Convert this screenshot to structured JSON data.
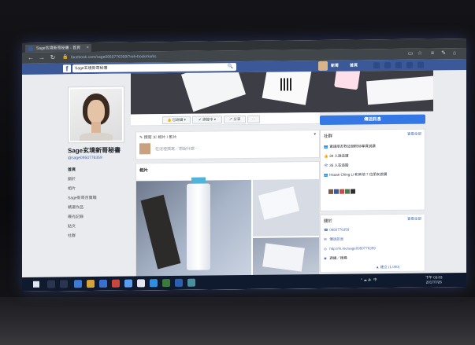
{
  "browser": {
    "tab_title": "Sage玄境新哥秘書 - 首頁",
    "tab_close": "×",
    "url": "facebook.com/sage0950776359/?ref=bookmarks",
    "back": "←",
    "forward": "→",
    "refresh": "↻",
    "lock": "🔒",
    "reading_view": "▭",
    "favorite": "☆",
    "hub": "≡",
    "notes": "✎",
    "share": "⌂"
  },
  "facebook": {
    "logo": "f",
    "search_value": "Sage玄境新哥秘書",
    "search_icon": "🔍",
    "nav_user": "新哥",
    "nav_home": "首頁"
  },
  "page": {
    "name": "Sage玄境新哥秘書",
    "handle": "@sage0950776359",
    "menu": [
      "首頁",
      "關於",
      "相片",
      "Sage新哥百寶箱",
      "精選作品",
      "曝光記錄",
      "貼文",
      "社群"
    ]
  },
  "actions": {
    "liked": "👍 已說讚 ▾",
    "following": "✔ 追蹤中 ▾",
    "share": "↗ 分享",
    "more": "···",
    "send_message": "傳送訊息"
  },
  "composer": {
    "tabs": "✎ 撰寫  ▣ 相片 / 影片",
    "more": "▾",
    "placeholder": "在這裡撰寫／想說什麼⋯"
  },
  "photos": {
    "header": "相片"
  },
  "community": {
    "title": "社群",
    "see_all": "查看全部",
    "rows": [
      {
        "icon": "👥",
        "text": "邀請朋友對這個粉絲專頁說讚"
      },
      {
        "icon": "👍",
        "text": "38 人說這讚"
      },
      {
        "icon": "👁",
        "text": "35 人在追蹤"
      },
      {
        "icon": "👥",
        "text": "Hsuan Ching Li 和其他 7 位朋友說讚"
      }
    ]
  },
  "about": {
    "title": "關於",
    "see_all": "查看全部",
    "rows": [
      {
        "icon": "☎",
        "text": "0950776359"
      },
      {
        "icon": "✉",
        "text": "傳送訊息"
      },
      {
        "icon": "◎",
        "text": "http://m.me/sage0950776359"
      },
      {
        "icon": "◉",
        "text": "週播／搜尋"
      }
    ],
    "footer": "▲ 建立 (1,000)"
  },
  "taskbar": {
    "tray": "^ ☁ 🔈 中 ",
    "time": "下午 03:03",
    "date": "2017/7/26"
  },
  "colors": {
    "facebook_blue": "#3b5998",
    "accent": "#3578e5",
    "taskbar": "#101a2e"
  }
}
